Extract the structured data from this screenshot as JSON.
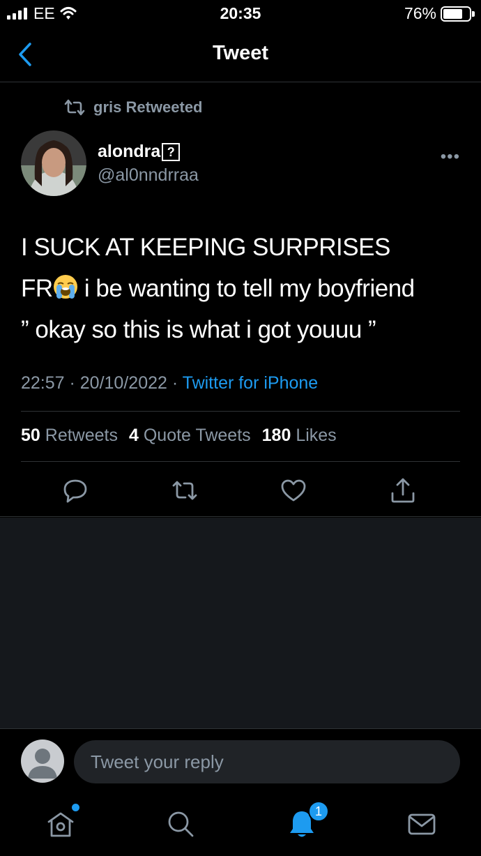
{
  "status_bar": {
    "carrier": "EE",
    "time": "20:35",
    "battery_percent": "76%",
    "battery_level": 0.76
  },
  "header": {
    "title": "Tweet",
    "back_icon": "chevron-left-icon"
  },
  "tweet": {
    "retweeted_by": "gris Retweeted",
    "author": {
      "display_name": "alondra",
      "name_glyph": "?",
      "handle": "@al0nndrraa"
    },
    "text": {
      "line1": "I SUCK AT KEEPING SURPRISES",
      "line2_prefix": "FR",
      "line2_suffix": " i be wanting to tell my boyfriend",
      "line3": "” okay so this is what i got youuu ”",
      "emoji": "loudly-crying-face"
    },
    "timestamp": "22:57 · 20/10/2022 · ",
    "source": "Twitter for iPhone",
    "stats": {
      "retweets_count": "50",
      "retweets_label": "Retweets",
      "quotes_count": "4",
      "quotes_label": "Quote Tweets",
      "likes_count": "180",
      "likes_label": "Likes"
    },
    "actions": [
      "reply-icon",
      "retweet-icon",
      "like-icon",
      "share-icon"
    ]
  },
  "reply": {
    "placeholder": "Tweet your reply"
  },
  "tabbar": {
    "tabs": [
      "home-icon",
      "search-icon",
      "notifications-icon",
      "messages-icon"
    ],
    "notifications_badge": "1"
  },
  "colors": {
    "accent": "#1d9bf0",
    "secondary_text": "#8b98a5",
    "background": "#000000",
    "empty_area": "#15181c"
  }
}
